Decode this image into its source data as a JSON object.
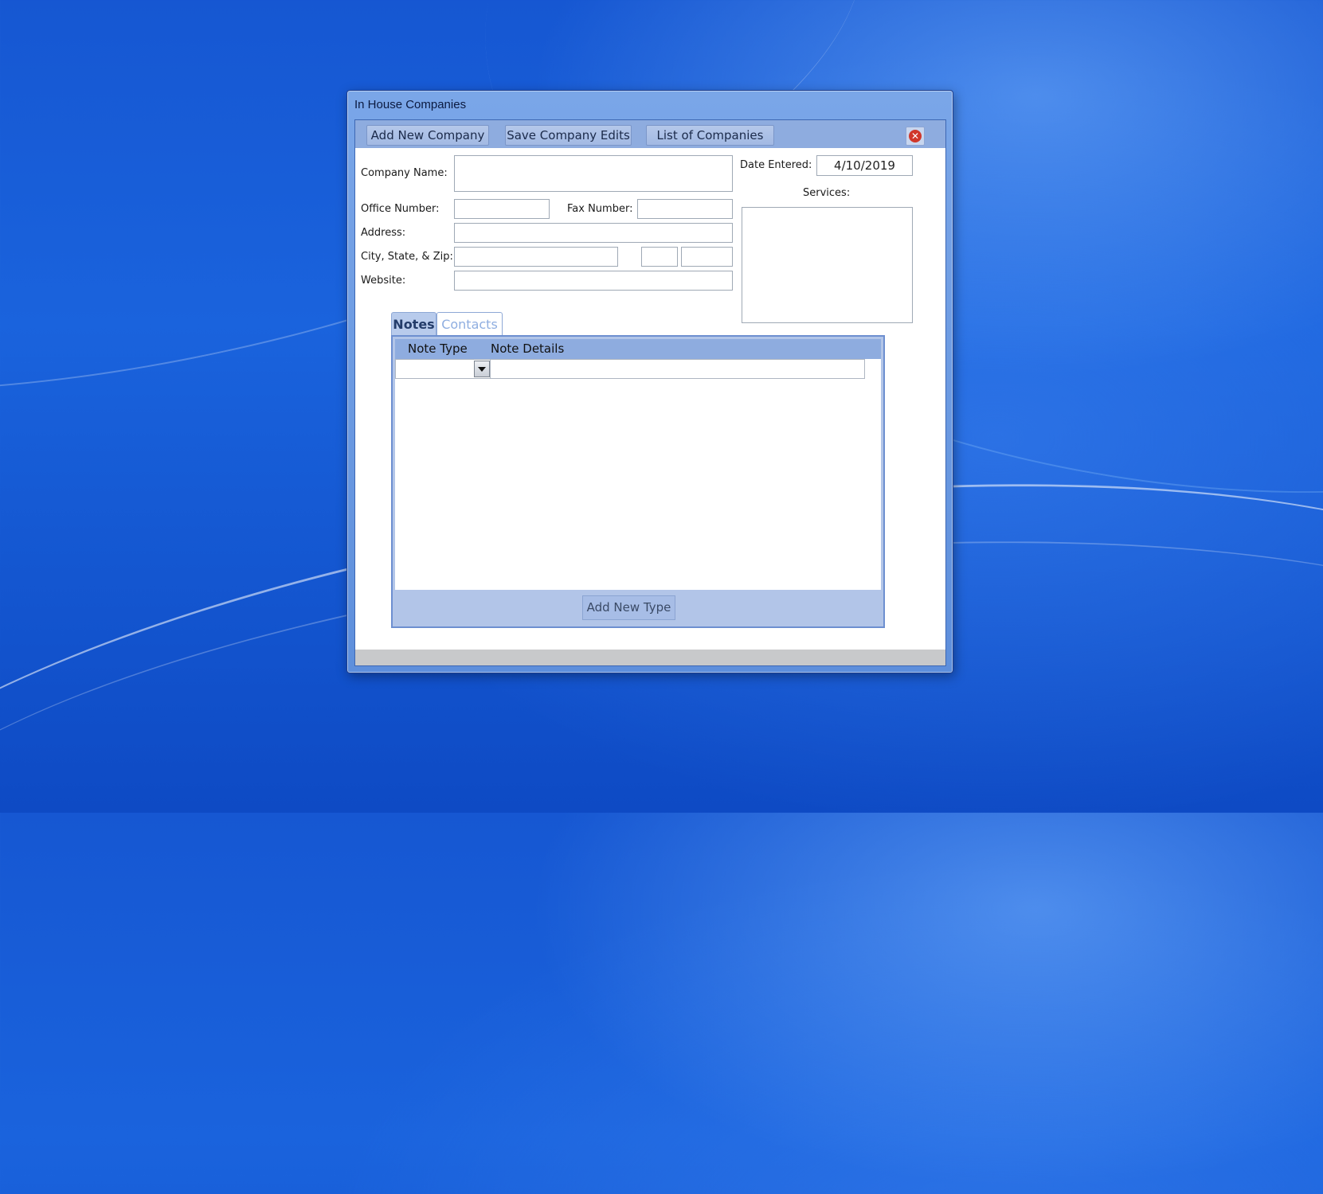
{
  "window": {
    "title": "In House Companies"
  },
  "toolbar": {
    "add_new_company": "Add New Company",
    "save_company_edits": "Save Company Edits",
    "list_of_companies": "List of Companies",
    "close_icon": "close-icon"
  },
  "form": {
    "company_name_label": "Company Name:",
    "company_name_value": "",
    "office_number_label": "Office Number:",
    "office_number_value": "",
    "fax_number_label": "Fax Number:",
    "fax_number_value": "",
    "address_label": "Address:",
    "address_value": "",
    "city_state_zip_label": "City, State, & Zip:",
    "city_value": "",
    "state_value": "",
    "zip_value": "",
    "website_label": "Website:",
    "website_value": "",
    "date_entered_label": "Date Entered:",
    "date_entered_value": "4/10/2019",
    "services_label": "Services:"
  },
  "tabs": [
    {
      "label": "Notes",
      "active": true
    },
    {
      "label": "Contacts",
      "active": false
    }
  ],
  "notes_grid": {
    "columns": [
      "Note Type",
      "Note Details"
    ],
    "rows": [
      {
        "note_type": "",
        "note_details": ""
      }
    ]
  },
  "add_new_type_label": "Add New Type",
  "colors": {
    "toolbar": "#8eacdf",
    "tab_active": "#b8cbec",
    "close_icon": "#d0372b"
  }
}
